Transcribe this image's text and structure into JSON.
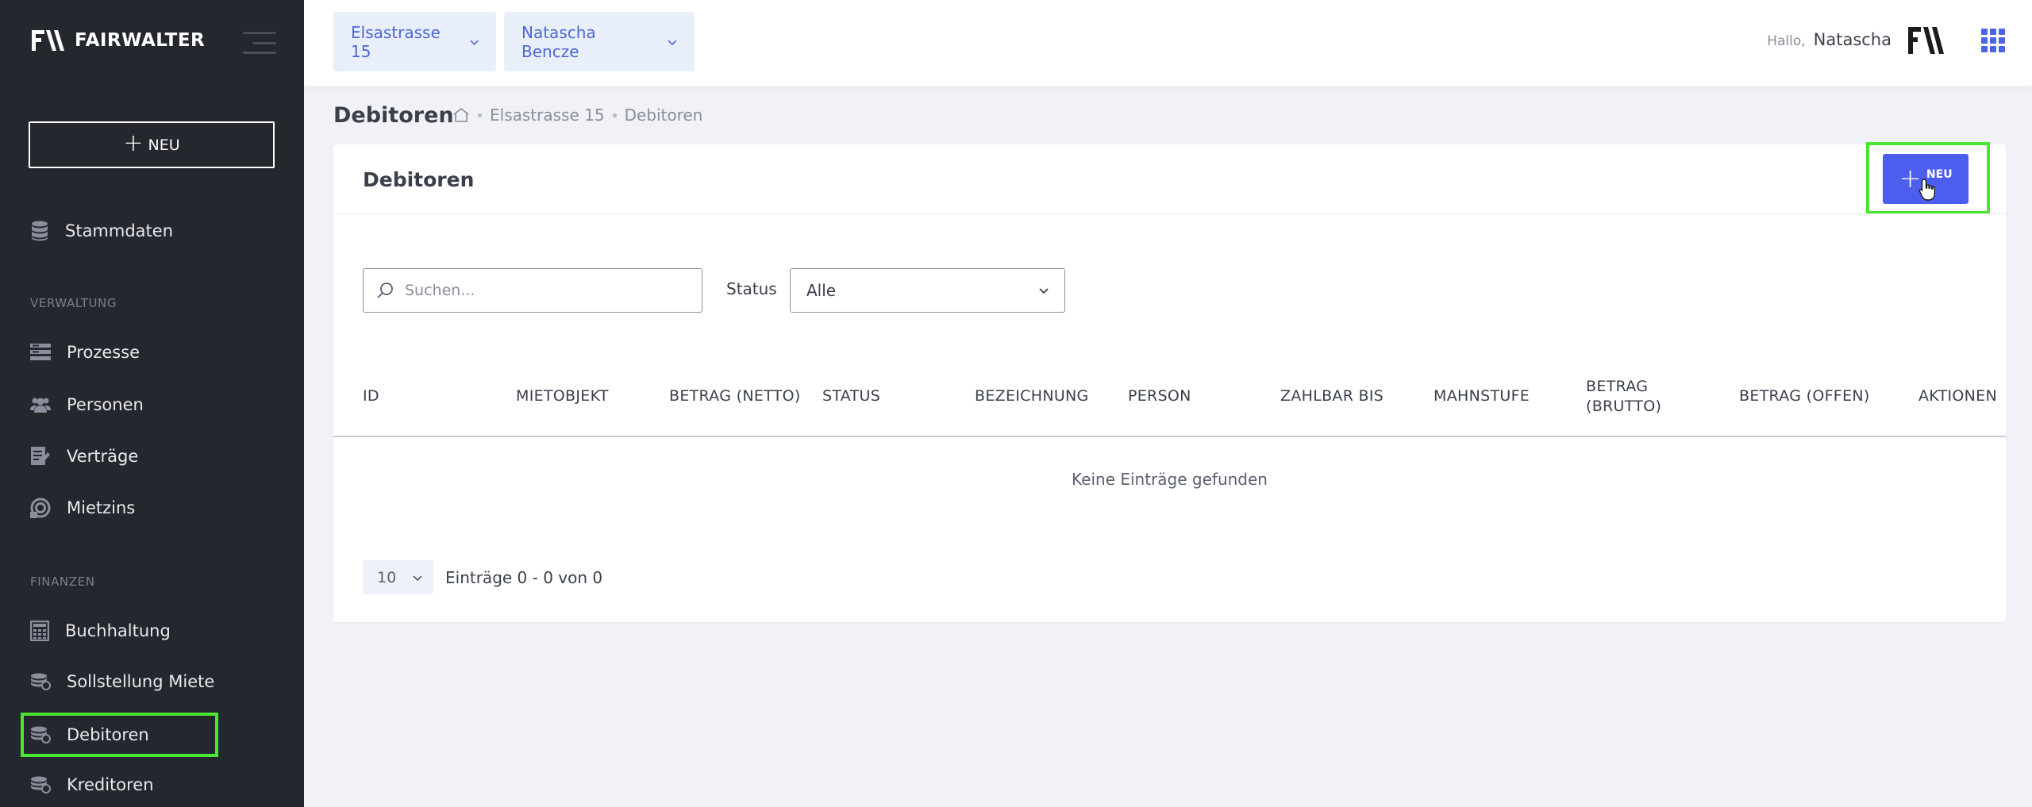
{
  "app": {
    "logo_text": "FAIRWALTER"
  },
  "sidebar": {
    "new_button": "NEU",
    "items_top": [
      {
        "label": "Stammdaten",
        "icon": "database-icon"
      }
    ],
    "section_verwaltung": "VERWALTUNG",
    "items_verwaltung": [
      {
        "label": "Prozesse",
        "icon": "process-icon"
      },
      {
        "label": "Personen",
        "icon": "people-icon"
      },
      {
        "label": "Verträge",
        "icon": "contract-icon"
      },
      {
        "label": "Mietzins",
        "icon": "coins-icon"
      }
    ],
    "section_finanzen": "FINANZEN",
    "items_finanzen": [
      {
        "label": "Buchhaltung",
        "icon": "calculator-icon"
      },
      {
        "label": "Sollstellung Miete",
        "icon": "coins-stack-icon"
      },
      {
        "label": "Debitoren",
        "icon": "coins-stack-icon",
        "active": true
      },
      {
        "label": "Kreditoren",
        "icon": "coins-stack-icon"
      }
    ]
  },
  "topbar": {
    "property_select": "Elsastrasse 15",
    "person_select": "Natascha Bencze",
    "greeting": "Hallo,",
    "user_name": "Natascha"
  },
  "page": {
    "title": "Debitoren",
    "breadcrumb": [
      "Elsastrasse 15",
      "Debitoren"
    ]
  },
  "card": {
    "title": "Debitoren",
    "add_button": "NEU",
    "search_placeholder": "Suchen...",
    "status_label": "Status",
    "status_value": "Alle",
    "columns": [
      "ID",
      "MIETOBJEKT",
      "BETRAG (NETTO)",
      "STATUS",
      "BEZEICHNUNG",
      "PERSON",
      "ZAHLBAR BIS",
      "MAHNSTUFE",
      "BETRAG (BRUTTO)",
      "BETRAG (OFFEN)",
      "AKTIONEN"
    ],
    "empty_text": "Keine Einträge gefunden",
    "page_size": "10",
    "page_info": "Einträge 0 - 0 von 0"
  },
  "colors": {
    "sidebar_bg": "#25272f",
    "accent": "#4b5ef0",
    "highlight": "#4be534",
    "select_bg": "#e9eefb"
  }
}
